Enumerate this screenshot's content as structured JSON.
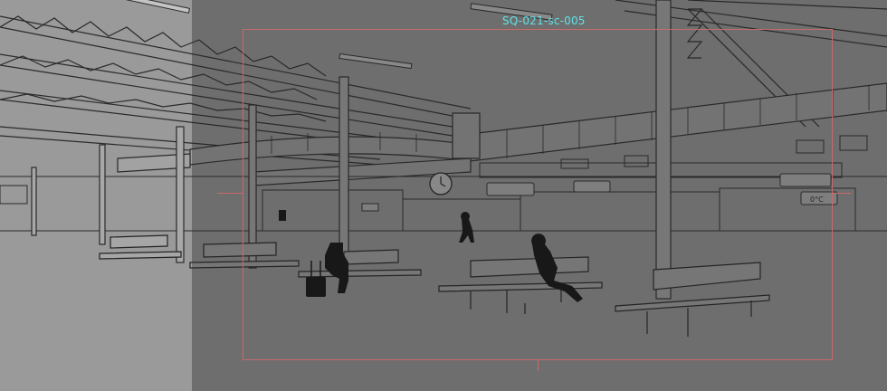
{
  "shot": {
    "label": "SQ-021-sc-005",
    "label_color": "#5fe3e8",
    "frame_color": "#c96a6a"
  },
  "scene": {
    "clock_icon": "clock-icon",
    "sign_text_left": "",
    "sign_text_right": "0°C"
  }
}
